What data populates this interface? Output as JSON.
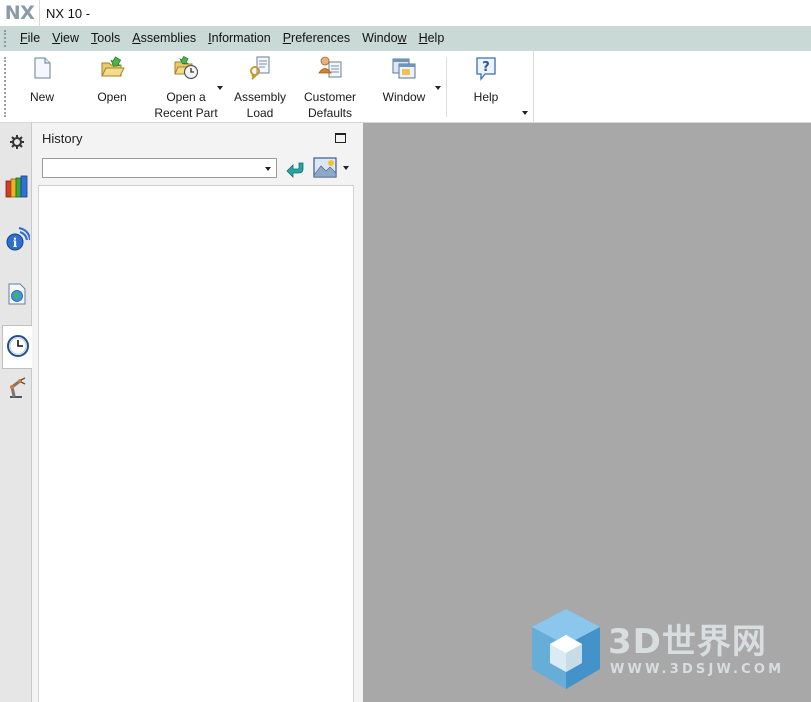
{
  "titlebar": {
    "logo": "NX",
    "title": "NX 10 -"
  },
  "menu": {
    "items": [
      {
        "label": "File",
        "mnemonic": "F",
        "rest": "ile"
      },
      {
        "label": "View",
        "mnemonic": "V",
        "rest": "iew"
      },
      {
        "label": "Tools",
        "mnemonic": "T",
        "rest": "ools"
      },
      {
        "label": "Assemblies",
        "mnemonic": "A",
        "rest": "ssemblies"
      },
      {
        "label": "Information",
        "mnemonic": "I",
        "rest": "nformation"
      },
      {
        "label": "Preferences",
        "mnemonic": "P",
        "rest": "references"
      },
      {
        "label": "Window",
        "pre": "Windo",
        "mnemonic": "w",
        "rest": ""
      },
      {
        "label": "Help",
        "mnemonic": "H",
        "rest": "elp"
      }
    ]
  },
  "ribbon": {
    "new": {
      "line1": "New",
      "icon": "new-document-icon"
    },
    "open": {
      "line1": "Open",
      "icon": "open-folder-icon"
    },
    "recent": {
      "line1": "Open a",
      "line2": "Recent Part",
      "icon": "recent-part-icon"
    },
    "assembly": {
      "line1": "Assembly",
      "line2": "Load",
      "icon": "assembly-load-icon"
    },
    "defaults": {
      "line1": "Customer",
      "line2": "Defaults",
      "icon": "customer-defaults-icon"
    },
    "window": {
      "line1": "Window",
      "icon": "window-icon"
    },
    "help": {
      "line1": "Help",
      "icon": "help-icon"
    }
  },
  "resource_bar": {
    "tabs": [
      {
        "icon": "gear-icon"
      },
      {
        "icon": "books-icon"
      },
      {
        "icon": "info-broadcast-icon"
      },
      {
        "icon": "web-document-icon"
      },
      {
        "icon": "clock-icon",
        "active": true
      },
      {
        "icon": "robot-arm-icon"
      }
    ]
  },
  "history_panel": {
    "title": "History",
    "combo_value": ""
  },
  "watermark": {
    "brand": "3D世界网",
    "url": "WWW.3DSJW.COM"
  },
  "colors": {
    "menubar_bg": "#c9dad6",
    "graphics_bg": "#a8a8a8",
    "logo": "#8a9aa8",
    "watermark_cube": "#4aa3d8"
  }
}
